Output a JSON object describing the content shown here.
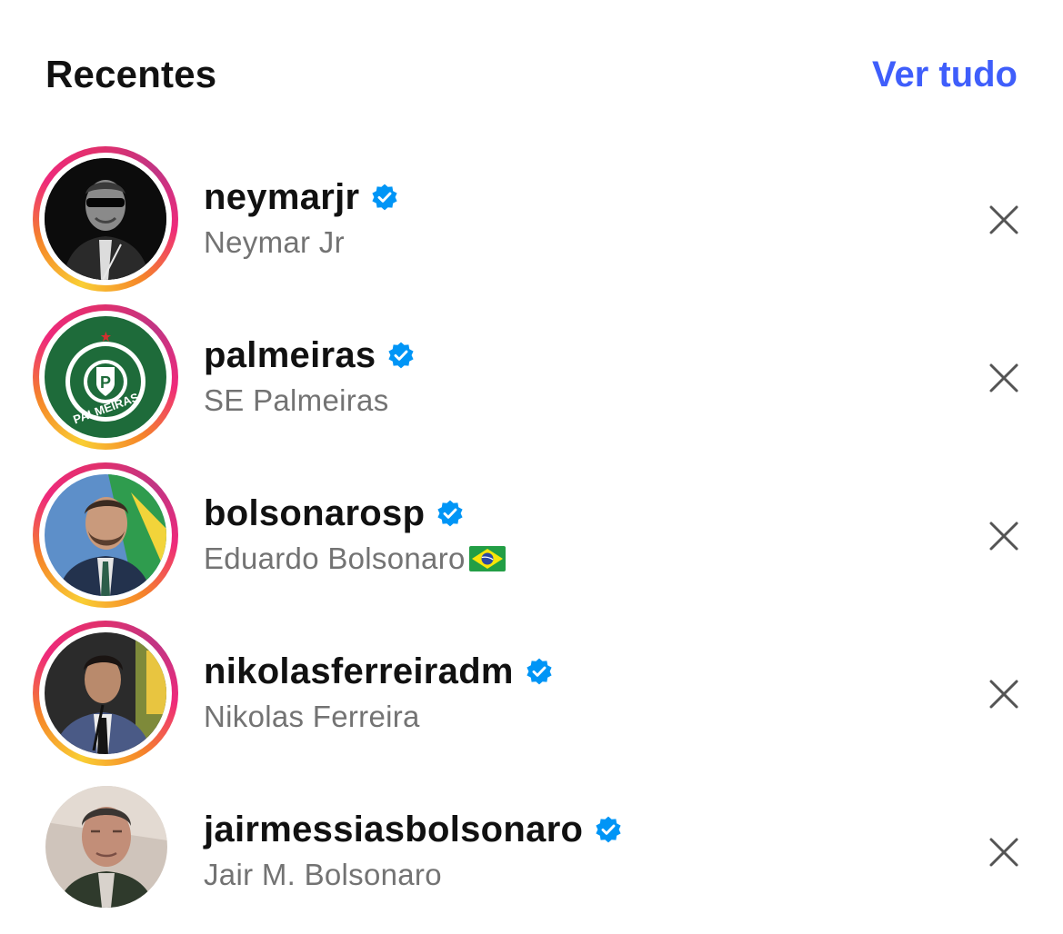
{
  "header": {
    "title": "Recentes",
    "see_all": "Ver tudo"
  },
  "colors": {
    "link": "#3f5efb",
    "verified": "#0095f6",
    "secondary_text": "#737373"
  },
  "recent_items": [
    {
      "username": "neymarjr",
      "full_name": "Neymar Jr",
      "verified": true,
      "story_ring": true,
      "avatar_icon": "neymar-avatar-icon"
    },
    {
      "username": "palmeiras",
      "full_name": "SE Palmeiras",
      "verified": true,
      "story_ring": true,
      "avatar_icon": "palmeiras-logo-icon"
    },
    {
      "username": "bolsonarosp",
      "full_name": "Eduardo Bolsonaro",
      "full_name_suffix": "🇧🇷",
      "verified": true,
      "story_ring": true,
      "avatar_icon": "bolsonarosp-avatar-icon"
    },
    {
      "username": "nikolasferreiradm",
      "full_name": "Nikolas Ferreira",
      "verified": true,
      "story_ring": true,
      "avatar_icon": "nikolas-avatar-icon"
    },
    {
      "username": "jairmessiasbolsonaro",
      "full_name": "Jair M. Bolsonaro",
      "verified": true,
      "story_ring": false,
      "avatar_icon": "jair-avatar-icon"
    }
  ]
}
